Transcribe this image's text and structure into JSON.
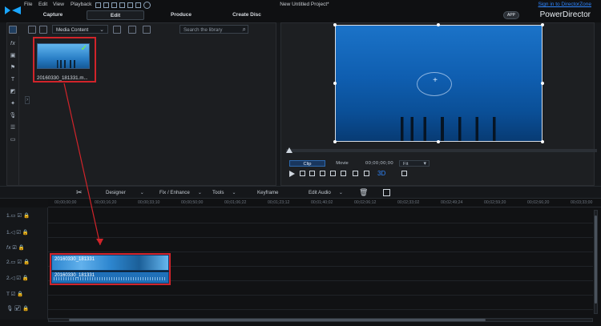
{
  "title": {
    "menu": [
      "File",
      "Edit",
      "View",
      "Playback"
    ],
    "project_name": "New Untitled Project*",
    "signin_link": "Sign in to DirectorZone",
    "app_badge": "APP",
    "app_name": "PowerDirector"
  },
  "tabs": [
    {
      "label": "Capture"
    },
    {
      "label": "Edit"
    },
    {
      "label": "Produce"
    },
    {
      "label": "Create Disc"
    }
  ],
  "library": {
    "dropdown_label": "Media Content",
    "search_placeholder": "Search the library",
    "thumbnail_caption": "20160330_181331.m..."
  },
  "preview": {
    "clip_tab": "Clip",
    "movie_tab": "Movie",
    "timecode": "00;00;00;00",
    "fit": "Fit"
  },
  "toolbar": {
    "designer": "Designer",
    "fix_enhance": "Fix / Enhance",
    "tools": "Tools",
    "keyframe": "Keyframe",
    "edit_audio": "Edit Audio"
  },
  "timeline": {
    "ticks": [
      "00;00;00;00",
      "00;00;16;20",
      "00;00;33;10",
      "00;00;50;00",
      "00;01;06;22",
      "00;01;23;12",
      "00;01;40;02",
      "00;02;06;12",
      "00;02;33;02",
      "00;02;49;24",
      "00;02;59;20",
      "00;02;66;20",
      "00;03;33;00"
    ],
    "clip_name": "20160330_181331",
    "audio_clip_name": "20160330_181331"
  }
}
